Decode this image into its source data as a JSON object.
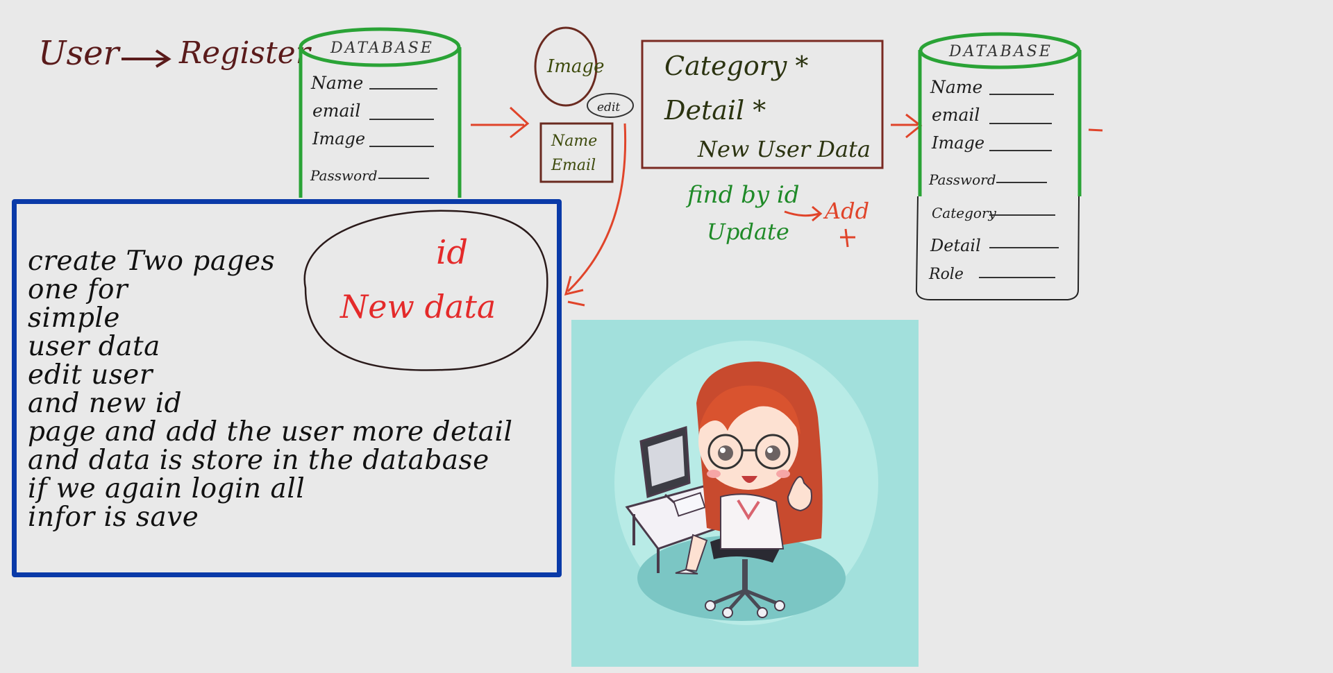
{
  "whiteboard": {
    "flow": {
      "user_label": "User",
      "register_label": "Register"
    },
    "database_left": {
      "title": "DATABASE",
      "fields": [
        "Name",
        "email",
        "Image",
        "Password"
      ]
    },
    "image_bubble": "Image",
    "edit_tag": "edit",
    "name_email_box": [
      "Name",
      "Email"
    ],
    "category_box": {
      "line1": "Category  *",
      "line2": "Detail  *",
      "line3": "New User Data"
    },
    "below_box": {
      "find": "find by id",
      "update": "Update",
      "add": "Add"
    },
    "database_right": {
      "title": "DATABASE",
      "fields": [
        "Name",
        "email",
        "Image",
        "Password",
        "Category",
        "Detail",
        "Role"
      ]
    },
    "oval": {
      "line1": "id",
      "line2": "New data"
    },
    "notes": [
      "create Two pages",
      "one for",
      "simple",
      "user data",
      "edit user",
      "and new id",
      "page and add the user more detail",
      "and data is store in the database",
      "if we again login all",
      "infor is save"
    ],
    "colors": {
      "background": "#e9e9e9",
      "maroon": "#5a1b1b",
      "green": "#1f9a2a",
      "red_arrow": "#e0442a",
      "blue_box": "#0a3aa8",
      "olive": "#3d4a0c",
      "picture_bg": "#a2e0dc"
    }
  }
}
